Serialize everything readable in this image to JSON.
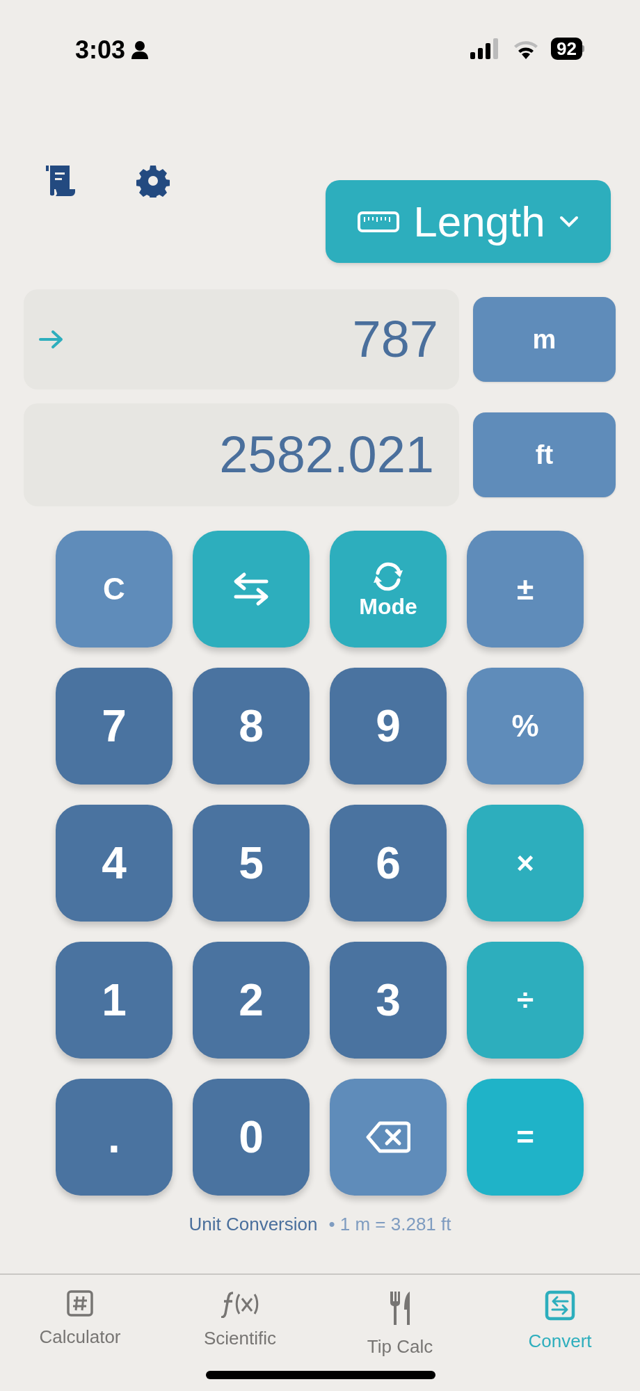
{
  "status_bar": {
    "time": "3:03",
    "battery": "92"
  },
  "category": {
    "label": "Length"
  },
  "input": {
    "value": "787",
    "unit": "m"
  },
  "output": {
    "value": "2582.021",
    "unit": "ft"
  },
  "keys": [
    {
      "kind": "function",
      "label": "C"
    },
    {
      "kind": "operator"
    },
    {
      "kind": "operator",
      "label": "Mode"
    },
    {
      "kind": "function",
      "label": "±"
    },
    {
      "kind": "number",
      "label": "7"
    },
    {
      "kind": "number",
      "label": "8"
    },
    {
      "kind": "number",
      "label": "9"
    },
    {
      "kind": "function",
      "label": "%"
    },
    {
      "kind": "number",
      "label": "4"
    },
    {
      "kind": "number",
      "label": "5"
    },
    {
      "kind": "number",
      "label": "6"
    },
    {
      "kind": "operator",
      "label": "×"
    },
    {
      "kind": "number",
      "label": "1"
    },
    {
      "kind": "number",
      "label": "2"
    },
    {
      "kind": "number",
      "label": "3"
    },
    {
      "kind": "operator",
      "label": "÷"
    },
    {
      "kind": "number",
      "label": "."
    },
    {
      "kind": "number",
      "label": "0"
    },
    {
      "kind": "function"
    },
    {
      "kind": "equals",
      "label": "="
    }
  ],
  "footer": {
    "mode": "Unit Conversion",
    "rate": "• 1 m = 3.281 ft"
  },
  "tabs": [
    {
      "label": "Calculator",
      "selected": false
    },
    {
      "label": "Scientific",
      "selected": false
    },
    {
      "label": "Tip Calc",
      "selected": false
    },
    {
      "label": "Convert",
      "selected": true
    }
  ]
}
